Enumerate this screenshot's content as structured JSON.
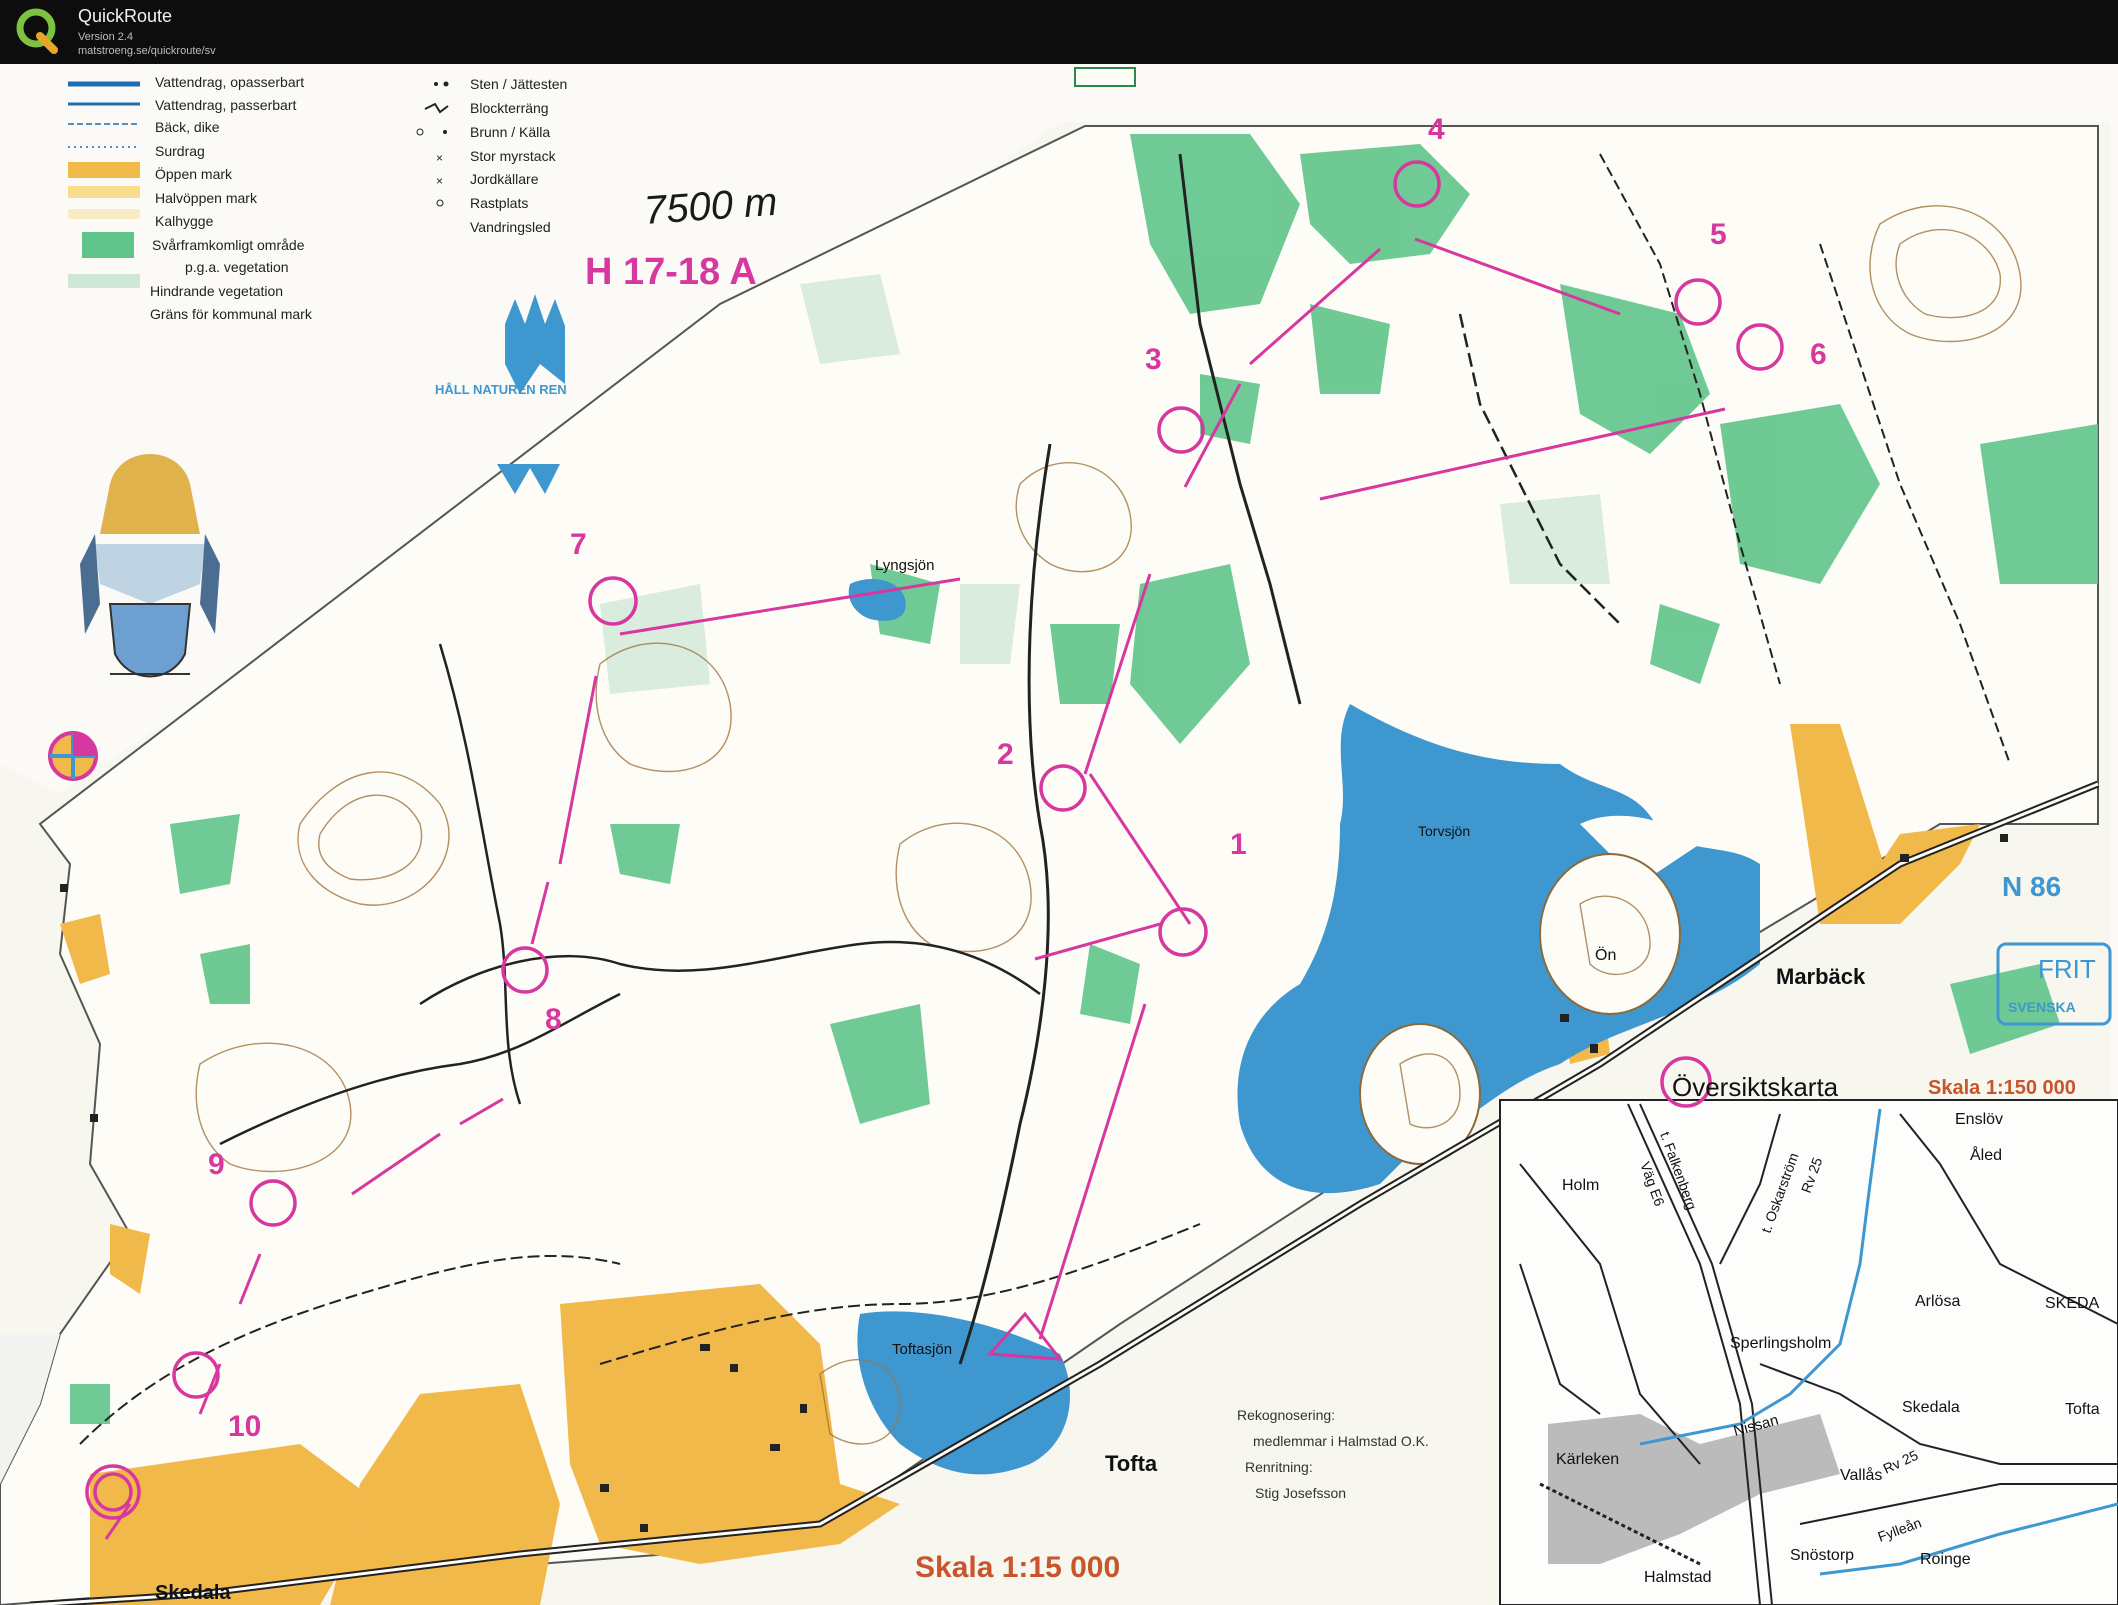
{
  "app": {
    "title": "QuickRoute",
    "version": "Version 2.4",
    "url": "matstroeng.se/quickroute/sv"
  },
  "legend": {
    "items": [
      "Vattendrag, opasserbart",
      "Vattendrag, passerbart",
      "Bäck, dike",
      "Surdrag",
      "Öppen mark",
      "Halvöppen mark",
      "Kalhygge",
      "Svårframkomligt område",
      "p.g.a. vegetation",
      "Hindrande vegetation",
      "Gräns för kommunal mark"
    ],
    "items_right": [
      "Sten / Jättesten",
      "Blockterräng",
      "Brunn / Källa",
      "Stor myrstack",
      "Jordkällare",
      "Rastplats",
      "Vandringsled"
    ]
  },
  "course": {
    "distance": "7500 m",
    "class": "H 17-18 A",
    "controls": [
      "1",
      "2",
      "3",
      "4",
      "5",
      "6",
      "7",
      "8",
      "9",
      "10"
    ]
  },
  "place_names": {
    "lyngsjon": "Lyngsjön",
    "torvsjon": "Torvsjön",
    "on": "Ön",
    "toftasjon": "Toftasjön",
    "tofta": "Tofta",
    "marback": "Marbäck",
    "skedala": "Skedala"
  },
  "credits": {
    "rekognosering_label": "Rekognosering:",
    "rekognosering_value": "medlemmar i Halmstad O.K.",
    "renritning_label": "Renritning:",
    "renritning_value": "Stig Josefsson"
  },
  "scale": "Skala 1:15 000",
  "hall_naturen_ren": "HÅLL NATUREN REN",
  "grid_north": "N 86",
  "fritid": "FRIT",
  "svenska": "SVENSKA",
  "overview": {
    "title": "Översiktskarta",
    "scale": "Skala 1:150 000",
    "places": [
      "Enslöv",
      "Åled",
      "Holm",
      "t. Falkenberg",
      "Väg E6",
      "t. Oskarström",
      "Rv 25",
      "Arlösa",
      "SKEDA",
      "Sperlingsholm",
      "Kärleken",
      "Nissan",
      "Skedala",
      "Tofta",
      "Vallås",
      "Rv 25",
      "Fylleån",
      "Snöstorp",
      "Roinge",
      "Halmstad"
    ]
  },
  "colors": {
    "open_land": "#f1b84a",
    "water": "#3f97d0",
    "forest_green": "#5fc489",
    "course_magenta": "#d6389f",
    "titlebar": "#0d0d0d"
  }
}
